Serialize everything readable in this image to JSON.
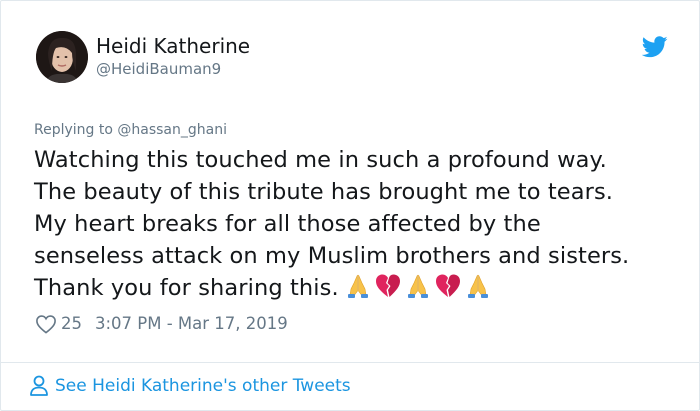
{
  "tweet": {
    "author_name": "Heidi Katherine",
    "author_handle": "@HeidiBauman9",
    "replying_to": "Replying to @hassan_ghani",
    "text_lines": [
      "Watching this touched me in such a profound way.",
      "The beauty of this tribute has brought me to tears.",
      "My heart breaks for all those affected by the",
      "senseless attack on my Muslim brothers and sisters.",
      "Thank you for sharing this."
    ],
    "emojis": [
      "folded-hands",
      "broken-heart",
      "folded-hands",
      "broken-heart",
      "folded-hands"
    ],
    "like_count": "25",
    "timestamp": "3:07 PM - Mar 17, 2019"
  },
  "footer": {
    "see_more_label": "See Heidi Katherine's other Tweets"
  },
  "icons": {
    "brand": "twitter-bird-icon",
    "like": "heart-outline-icon",
    "profile": "person-icon"
  },
  "colors": {
    "twitter_blue": "#1da1f2",
    "link_blue": "#1b95e0",
    "text": "#14171a",
    "muted": "#657786",
    "border": "#e1e8ed"
  }
}
